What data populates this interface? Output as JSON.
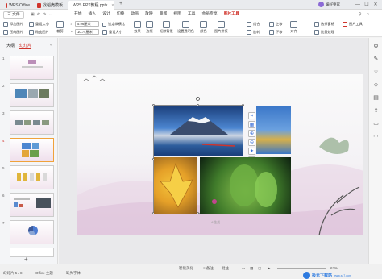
{
  "window": {
    "tabs": [
      {
        "label": "WPS Office",
        "color": "#d0342c"
      },
      {
        "label": "找稻壳模板",
        "color": "#d0342c"
      },
      {
        "label": "WPS PPT教程.pptx",
        "color": "#e2592b"
      }
    ],
    "new_tab": "+",
    "controls": {
      "minimize": "—",
      "maximize": "☐",
      "close": "✕"
    },
    "user_label": "编好要家"
  },
  "menu": {
    "items": [
      "三 文件",
      "开始",
      "插入",
      "设计",
      "切换",
      "动画",
      "放映",
      "审阅",
      "视图",
      "工具",
      "会员专享",
      "图片工具"
    ],
    "active": "图片工具",
    "right_items": [
      "○",
      "⚲"
    ]
  },
  "ribbon": {
    "crop_label": "裁剪",
    "items_left": [
      {
        "label": "添加图片",
        "row": 1
      },
      {
        "label": "压缩图片",
        "row": 2
      },
      {
        "label": "重设大小",
        "row": 1
      },
      {
        "label": "改变图片",
        "row": 2
      }
    ],
    "height_value": "5.96厘米",
    "width_value": "10.74厘米",
    "lock_ratio": "锁定纵横比",
    "reset_size": "重设大小",
    "effects": "效果",
    "border": "边框",
    "crop_pic": "抠除背景",
    "set_transparent": "设置透明色",
    "color": "颜色",
    "picture_tools": "图片拼接",
    "combine": "组合",
    "rotate": "旋转",
    "bring_forward": "上移",
    "send_backward": "下移",
    "align": "对齐",
    "selection_pane": "选择窗格",
    "batch": "批量处理",
    "more_tools": "图片工具"
  },
  "left_panel": {
    "tabs": [
      "大纲",
      "幻灯片"
    ],
    "active_tab": "幻灯片",
    "slide_numbers": [
      "1",
      "2",
      "3",
      "4",
      "5",
      "6",
      "7"
    ],
    "selected": "5",
    "add_slide": "+"
  },
  "slide": {
    "footer": "单击此处添加备注",
    "caption": "AI生成"
  },
  "status": {
    "slide_info": "幻灯片 5 / 8",
    "theme": "Office 主题",
    "missing_font": "缺失字体",
    "smart_beautify": "智能美化",
    "notes": "≡ 备注",
    "comments": "批注",
    "zoom": "63%"
  },
  "watermark": {
    "site": "极光下载站",
    "url": "www.xz7.com"
  },
  "colors": {
    "accent": "#d0342c",
    "selection": "#f0a23b",
    "sky": "#4c86d1"
  }
}
